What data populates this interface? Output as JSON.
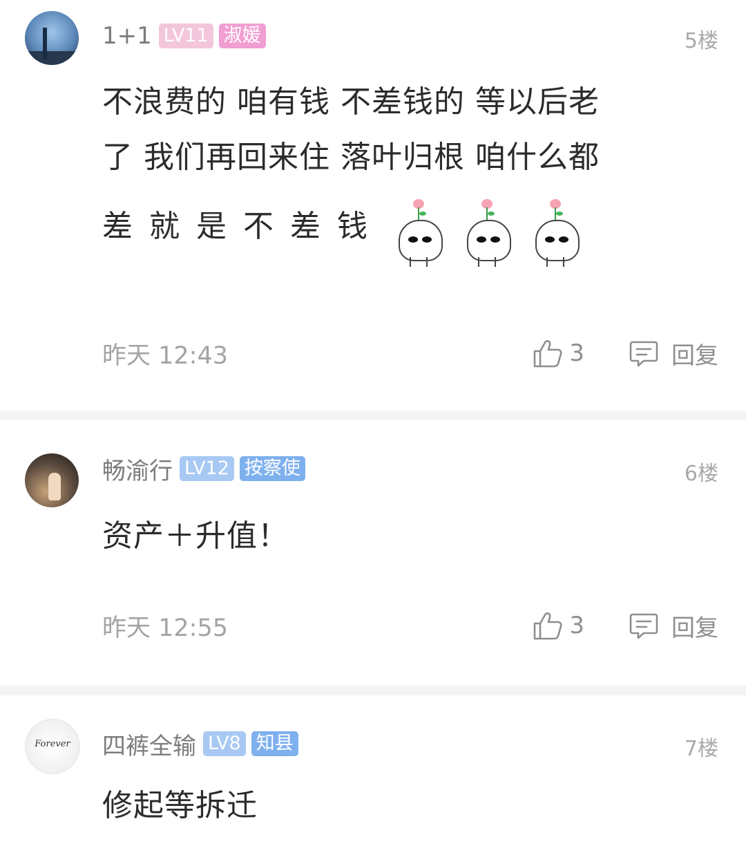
{
  "colors": {
    "lv_badge_pink": "#f4c6dc",
    "title_badge_pink": "#f19ed2",
    "lv_badge_blue": "#a8c9f3",
    "title_badge_blue": "#7fb0ee",
    "divider": "#f4f4f6"
  },
  "comments": [
    {
      "username": "1+1",
      "level": "LV11",
      "title": "淑媛",
      "floor": "5楼",
      "lines": [
        "不浪费的 咱有钱 不差钱的 等以后老",
        "了 我们再回来住 落叶归根 咱什么都",
        "差就是不差钱"
      ],
      "stickers": [
        "sprout-face-sticker",
        "sprout-face-sticker",
        "sprout-face-sticker"
      ],
      "time": "昨天 12:43",
      "likes": "3",
      "reply_label": "回复"
    },
    {
      "username": "畅渝行",
      "level": "LV12",
      "title": "按察使",
      "floor": "6楼",
      "lines": [
        "资产＋升值！"
      ],
      "time": "昨天 12:55",
      "likes": "3",
      "reply_label": "回复"
    },
    {
      "username": "四裤全输",
      "level": "LV8",
      "title": "知县",
      "floor": "7楼",
      "lines": [
        "修起等拆迁"
      ],
      "avatar_text": "Forever"
    }
  ]
}
